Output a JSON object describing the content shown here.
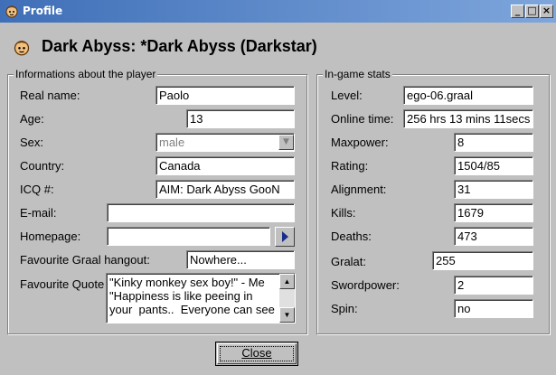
{
  "window": {
    "title": "Profile",
    "header": "Dark Abyss: *Dark Abyss (Darkstar)"
  },
  "player_group": {
    "legend": "Informations about the player",
    "real_name": {
      "label": "Real name:",
      "value": "Paolo"
    },
    "age": {
      "label": "Age:",
      "value": "13"
    },
    "sex": {
      "label": "Sex:",
      "value": "male"
    },
    "country": {
      "label": "Country:",
      "value": "Canada"
    },
    "icq": {
      "label": "ICQ #:",
      "value": "AIM: Dark Abyss GooN"
    },
    "email": {
      "label": "E-mail:",
      "value": ""
    },
    "homepage": {
      "label": "Homepage:",
      "value": ""
    },
    "hangout": {
      "label": "Favourite Graal hangout:",
      "value": "Nowhere..."
    },
    "quote": {
      "label": "Favourite Quote",
      "value": "\"Kinky monkey sex boy!\" - Me\n\"Happiness is like peeing in your  pants..  Everyone can see"
    }
  },
  "stats_group": {
    "legend": "In-game stats",
    "level": {
      "label": "Level:",
      "value": "ego-06.graal"
    },
    "online_time": {
      "label": "Online time:",
      "value": "256 hrs 13 mins 11secs"
    },
    "maxpower": {
      "label": "Maxpower:",
      "value": "8"
    },
    "rating": {
      "label": "Rating:",
      "value": "1504/85"
    },
    "alignment": {
      "label": "Alignment:",
      "value": "31"
    },
    "kills": {
      "label": "Kills:",
      "value": "1679"
    },
    "deaths": {
      "label": "Deaths:",
      "value": "473"
    },
    "gralat": {
      "label": "Gralat:",
      "value": "255"
    },
    "swordpower": {
      "label": "Swordpower:",
      "value": "2"
    },
    "spin": {
      "label": "Spin:",
      "value": "no"
    }
  },
  "buttons": {
    "close": "Close",
    "minimize": "_",
    "maximize": "□",
    "window_close": "×"
  },
  "colors": {
    "titlebar": "#3f6fb8",
    "face": "#f0c080",
    "button_face": "#c0c0c0"
  },
  "icons": {
    "title": "player-face-icon",
    "header": "player-face-icon",
    "nav": "arrow-right-icon"
  }
}
